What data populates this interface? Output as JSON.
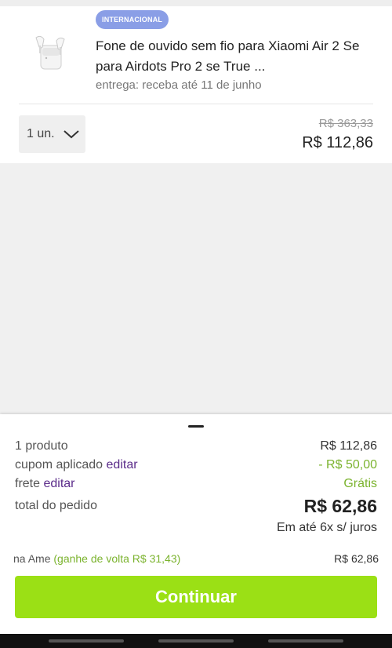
{
  "product": {
    "badge": "INTERNACIONAL",
    "title": "Fone de ouvido sem fio para Xiaomi Air 2 Se para Airdots Pro 2 se True ...",
    "delivery": "entrega: receba até 11 de junho",
    "quantity": "1 un.",
    "old_price": "R$ 363,33",
    "price": "R$ 112,86",
    "image_icon": "earbuds-product-image"
  },
  "summary": {
    "products_label": "1 produto",
    "products_value": "R$ 112,86",
    "coupon_label": "cupom aplicado",
    "coupon_edit": "editar",
    "coupon_value": "- R$ 50,00",
    "shipping_label": "frete",
    "shipping_edit": "editar",
    "shipping_value": "Grátis",
    "total_label": "total do pedido",
    "total_value": "R$ 62,86",
    "installments": "Em até 6x s/ juros",
    "ame_label": "na Ame",
    "ame_cashback": "(ganhe de volta R$ 31,43)",
    "ame_value": "R$ 62,86",
    "continue_label": "Continuar"
  },
  "colors": {
    "badge": "#8a9ee6",
    "link": "#5b2c8a",
    "green": "#7bb32e",
    "cta": "#9be015"
  }
}
